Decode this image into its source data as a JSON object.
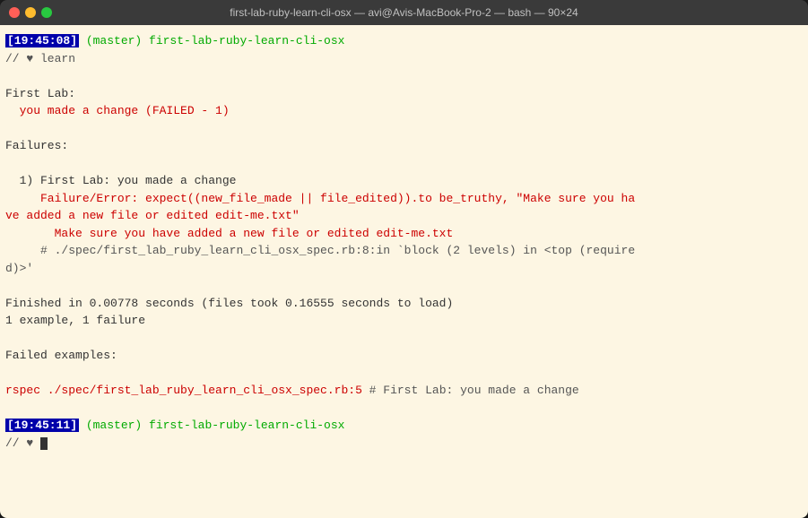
{
  "window": {
    "title": "first-lab-ruby-learn-cli-osx — avi@Avis-MacBook-Pro-2 — bash — 90×24"
  },
  "terminal": {
    "lines": [
      {
        "type": "prompt",
        "timestamp": "19:45:08",
        "text": " (master) first-lab-ruby-learn-cli-osx"
      },
      {
        "type": "comment",
        "text": "// ♥ learn"
      },
      {
        "type": "empty"
      },
      {
        "type": "text",
        "text": "First Lab:"
      },
      {
        "type": "red",
        "text": "  you made a change (FAILED - 1)"
      },
      {
        "type": "empty"
      },
      {
        "type": "text",
        "text": "Failures:"
      },
      {
        "type": "empty"
      },
      {
        "type": "text",
        "text": "  1) First Lab: you made a change"
      },
      {
        "type": "red",
        "text": "     Failure/Error: expect((new_file_made || file_edited)).to be_truthy, \"Make sure you ha"
      },
      {
        "type": "red",
        "text": "ve added a new file or edited edit-me.txt\""
      },
      {
        "type": "red_indent",
        "text": "       Make sure you have added a new file or edited edit-me.txt"
      },
      {
        "type": "comment_blue",
        "text": "     # ./spec/first_lab_ruby_learn_cli_osx_spec.rb:8:in `block (2 levels) in <top (require"
      },
      {
        "type": "comment_blue",
        "text": "d)>'"
      },
      {
        "type": "empty"
      },
      {
        "type": "text",
        "text": "Finished in 0.00778 seconds (files took 0.16555 seconds to load)"
      },
      {
        "type": "text",
        "text": "1 example, 1 failure"
      },
      {
        "type": "empty"
      },
      {
        "type": "text",
        "text": "Failed examples:"
      },
      {
        "type": "empty"
      },
      {
        "type": "rspec",
        "text": "rspec ./spec/first_lab_ruby_learn_cli_osx_spec.rb:5 # First Lab: you made a change"
      },
      {
        "type": "empty"
      },
      {
        "type": "prompt2",
        "timestamp": "19:45:11",
        "text": " (master) first-lab-ruby-learn-cli-osx"
      },
      {
        "type": "last_line"
      }
    ]
  }
}
